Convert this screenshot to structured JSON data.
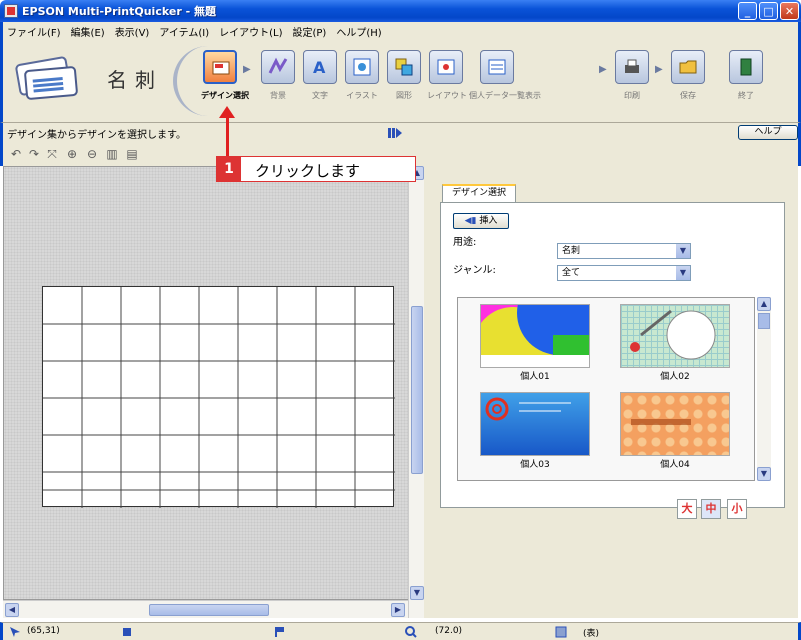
{
  "window": {
    "title": "EPSON Multi-PrintQuicker - 無題",
    "minimize_label": "_",
    "maximize_label": "□",
    "close_label": "✕"
  },
  "menu": [
    "ファイル(F)",
    "編集(E)",
    "表示(V)",
    "アイテム(I)",
    "レイアウト(L)",
    "設定(P)",
    "ヘルプ(H)"
  ],
  "mode": {
    "label": "名刺"
  },
  "toolbar": {
    "tools": [
      {
        "label": "デザイン選択",
        "icon": "design-select-icon",
        "active": true
      },
      {
        "label": "背景",
        "icon": "background-icon",
        "active": false
      },
      {
        "label": "文字",
        "icon": "text-icon",
        "active": false
      },
      {
        "label": "イラスト",
        "icon": "illustration-icon",
        "active": false
      },
      {
        "label": "図形",
        "icon": "shape-icon",
        "active": false
      },
      {
        "label": "レイアウト",
        "icon": "layout-icon",
        "active": false
      },
      {
        "label": "個人データ一覧表示",
        "icon": "personal-data-icon",
        "active": false
      },
      {
        "label": "印刷",
        "icon": "print-icon",
        "active": false
      },
      {
        "label": "保存",
        "icon": "save-icon",
        "active": false
      },
      {
        "label": "終了",
        "icon": "exit-icon",
        "active": false
      }
    ]
  },
  "hint": {
    "text": "デザイン集からデザインを選択します。",
    "help_label": "ヘルプ"
  },
  "callout": {
    "number": "1",
    "text": "クリックします"
  },
  "panel": {
    "tab_label": "デザイン選択",
    "insert_label": "挿入",
    "usage_label": "用途:",
    "usage_value": "名刺",
    "genre_label": "ジャンル:",
    "genre_value": "全て",
    "thumbnails": [
      "個人01",
      "個人02",
      "個人03",
      "個人04"
    ],
    "size_buttons": [
      "大",
      "中",
      "小"
    ]
  },
  "status": {
    "cursor_pos": "(65,31)",
    "zoom": "(72.0)",
    "extra": "(表)"
  }
}
